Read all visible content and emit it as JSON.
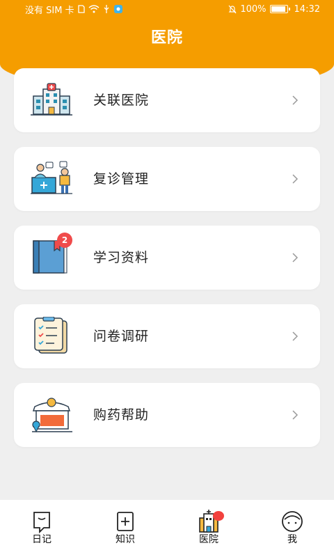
{
  "status_bar": {
    "carrier": "没有 SIM 卡",
    "battery": "100%",
    "time": "14:32"
  },
  "header": {
    "title": "医院"
  },
  "colors": {
    "accent": "#f59d00",
    "background": "#efefef",
    "badge": "#f2413e"
  },
  "cards": [
    {
      "label": "关联医院",
      "icon": "hospital-icon"
    },
    {
      "label": "复诊管理",
      "icon": "doctor-consult-icon"
    },
    {
      "label": "学习资料",
      "icon": "book-icon",
      "badge": "2"
    },
    {
      "label": "问卷调研",
      "icon": "checklist-icon"
    },
    {
      "label": "购药帮助",
      "icon": "pharmacy-store-icon"
    }
  ],
  "bottom_nav": {
    "items": [
      {
        "label": "日记",
        "icon": "diary-icon"
      },
      {
        "label": "知识",
        "icon": "knowledge-icon"
      },
      {
        "label": "医院",
        "icon": "hospital-nav-icon",
        "active": true
      },
      {
        "label": "我",
        "icon": "profile-icon"
      }
    ]
  }
}
